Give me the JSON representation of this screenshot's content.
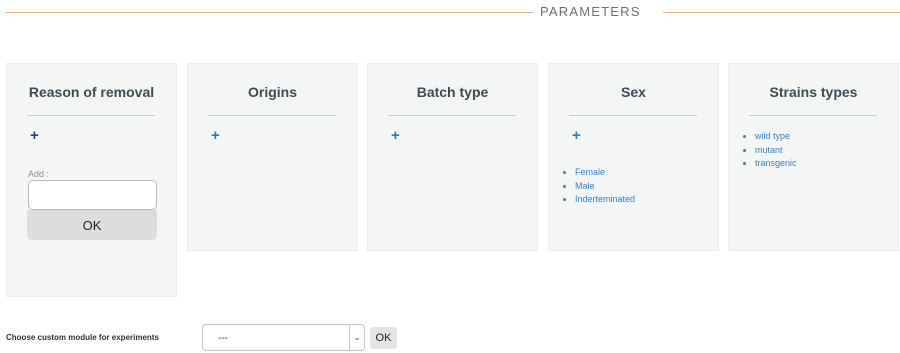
{
  "section": {
    "title": "PARAMETERS"
  },
  "panels": [
    {
      "title": "Reason of removal",
      "add_label": "Add :",
      "ok_label": "OK"
    },
    {
      "title": "Origins"
    },
    {
      "title": "Batch type"
    },
    {
      "title": "Sex",
      "items": [
        "Female",
        "Male",
        "Inderteminated"
      ]
    },
    {
      "title": "Strains types",
      "items": [
        "wild type",
        "mutant",
        "transgenic"
      ]
    }
  ],
  "plus_label": "+",
  "footer": {
    "label": "Choose custom module for experiments",
    "select_value": "---",
    "ok_label": "OK"
  }
}
